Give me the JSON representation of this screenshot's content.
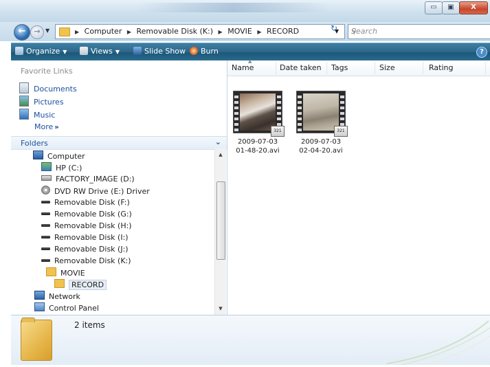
{
  "window": {
    "minimize_symbol": "▭",
    "maximize_symbol": "▣",
    "close_symbol": "X"
  },
  "address_bar": {
    "breadcrumbs": [
      "Computer",
      "Removable Disk (K:)",
      "MOVIE",
      "RECORD"
    ],
    "search_placeholder": "Search"
  },
  "toolbar": {
    "organize_label": "Organize",
    "views_label": "Views",
    "slideshow_label": "Slide Show",
    "burn_label": "Burn",
    "help_symbol": "?"
  },
  "favorites": {
    "heading": "Favorite Links",
    "items": [
      "Documents",
      "Pictures",
      "Music"
    ],
    "more_label": "More",
    "more_symbol": "»"
  },
  "folders": {
    "heading": "Folders",
    "chevron": "⌄",
    "tree": [
      {
        "label": "Computer",
        "icon": "computer-icon",
        "level": 1
      },
      {
        "label": "HP (C:)",
        "icon": "hard-drive-icon",
        "level": 2
      },
      {
        "label": "FACTORY_IMAGE (D:)",
        "icon": "hard-drive-icon",
        "level": 2
      },
      {
        "label": "DVD RW Drive (E:) Driver",
        "icon": "dvd-drive-icon",
        "level": 2
      },
      {
        "label": "Removable Disk (F:)",
        "icon": "removable-disk-icon",
        "level": 2
      },
      {
        "label": "Removable Disk (G:)",
        "icon": "removable-disk-icon",
        "level": 2
      },
      {
        "label": "Removable Disk (H:)",
        "icon": "removable-disk-icon",
        "level": 2
      },
      {
        "label": "Removable Disk (I:)",
        "icon": "removable-disk-icon",
        "level": 2
      },
      {
        "label": "Removable Disk (J:)",
        "icon": "removable-disk-icon",
        "level": 2
      },
      {
        "label": "Removable Disk (K:)",
        "icon": "removable-disk-icon",
        "level": 2
      },
      {
        "label": "MOVIE",
        "icon": "folder-icon",
        "level": 3
      },
      {
        "label": "RECORD",
        "icon": "folder-icon",
        "level": 4,
        "selected": true
      },
      {
        "label": "Network",
        "icon": "network-icon",
        "level": 1
      },
      {
        "label": "Control Panel",
        "icon": "control-panel-icon",
        "level": 1
      }
    ]
  },
  "columns": [
    "Name",
    "Date taken",
    "Tags",
    "Size",
    "Rating"
  ],
  "files": [
    {
      "line1": "2009-07-03",
      "line2": "01-48-20.avi",
      "badge": "321"
    },
    {
      "line1": "2009-07-03",
      "line2": "02-04-20.avi",
      "badge": "321"
    }
  ],
  "details": {
    "item_count": "2 items"
  }
}
